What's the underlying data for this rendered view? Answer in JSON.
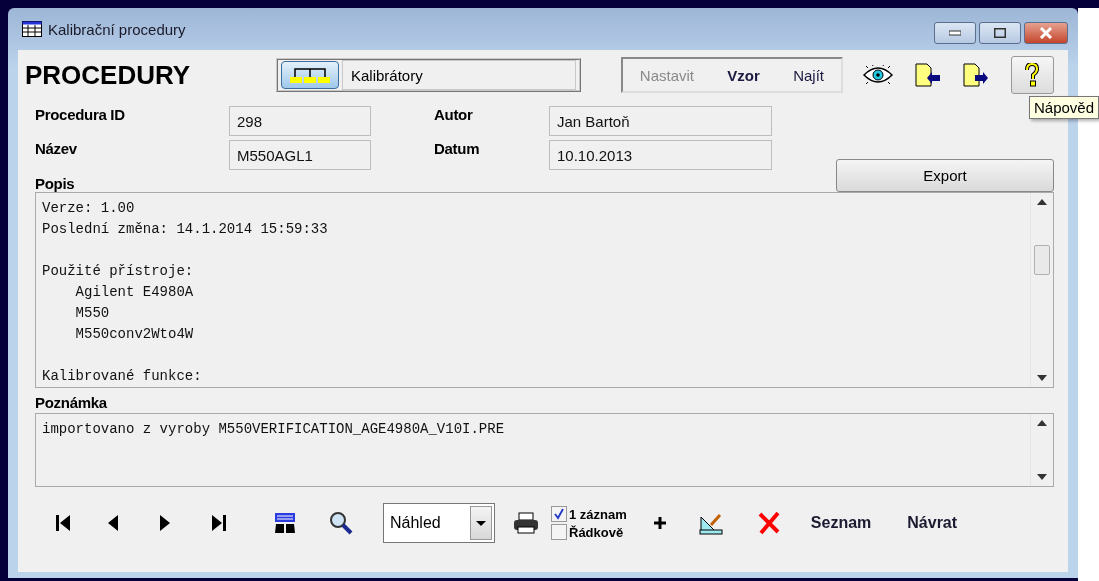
{
  "window": {
    "title": "Kalibrační procedury"
  },
  "header": {
    "title": "PROCEDURY",
    "group": {
      "value": "Kalibrátory"
    },
    "menu": [
      {
        "label": "Nastavit",
        "disabled": true,
        "selected": false
      },
      {
        "label": "Vzor",
        "disabled": false,
        "selected": true
      },
      {
        "label": "Najít",
        "disabled": false,
        "selected": false
      }
    ]
  },
  "tooltip": "Nápověd",
  "fields": [
    {
      "label": "Procedura ID",
      "value": "298"
    },
    {
      "label": "Název",
      "value": "M550AGL1"
    },
    {
      "label": "Autor",
      "value": "Jan Bartoň"
    },
    {
      "label": "Datum",
      "value": "10.10.2013"
    }
  ],
  "export_button": "Export",
  "description": {
    "label": "Popis",
    "text": "Verze: 1.00\nPoslední změna: 14.1.2014 15:59:33\n\nPoužité přístroje:\n    Agilent E4980A\n    M550\n    M550conv2Wto4W\n\nKalibrované funkce:"
  },
  "note": {
    "label": "Poznámka",
    "text": "importovano z vyroby M550VERIFICATION_AGE4980A_V10I.PRE"
  },
  "output": {
    "value": "Náhled"
  },
  "options": [
    {
      "label": "1 záznam",
      "checked": true
    },
    {
      "label": "Řádkově",
      "checked": false
    }
  ],
  "buttons": [
    "Seznam",
    "Návrat"
  ]
}
